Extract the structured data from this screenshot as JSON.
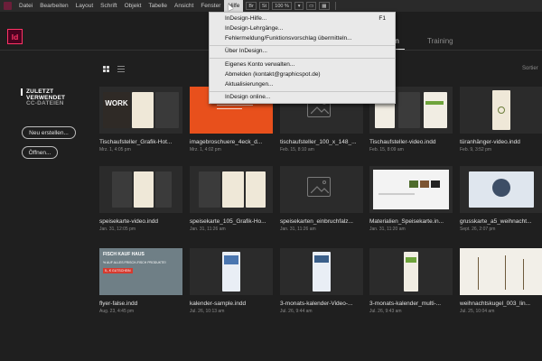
{
  "app": {
    "logo_text": "Id"
  },
  "menubar": {
    "items": [
      "Datei",
      "Bearbeiten",
      "Layout",
      "Schrift",
      "Objekt",
      "Tabelle",
      "Ansicht",
      "Fenster",
      "Hilfe"
    ],
    "active": "Hilfe",
    "zoom": "100 %"
  },
  "help_menu": {
    "items": [
      {
        "label": "InDesign-Hilfe...",
        "shortcut": "F1"
      },
      {
        "label": "InDesign-Lehrgänge..."
      },
      {
        "label": "Fehlermeldung/Funktionsvorschlag übermitteln..."
      },
      {
        "label": "Über InDesign..."
      },
      {
        "label": "Eigenes Konto verwalten..."
      },
      {
        "label": "Abmelden (kontakt@graphicspot.de)"
      },
      {
        "label": "Aktualisierungen..."
      },
      {
        "label": "InDesign online..."
      }
    ]
  },
  "tabs": {
    "dateien": "ateien",
    "training": "Training"
  },
  "sort_label": "Sortier",
  "sidebar": {
    "recent": "ZULETZT VERWENDET",
    "cc": "CC-DATEIEN",
    "new_button": "Neu erstellen...",
    "open_button": "Öffnen..."
  },
  "files": [
    {
      "name": "Tischaufsteller_Grafik-Hot...",
      "date": "Mrz. 1, 4:05 pm",
      "thumb": "work"
    },
    {
      "name": "imagebroschuere_4eck_d...",
      "date": "Mrz. 1, 4:02 pm",
      "thumb": "orange"
    },
    {
      "name": "tischaufsteller_100_x_148_...",
      "date": "Feb. 15, 8:10 am",
      "thumb": "placeholder"
    },
    {
      "name": "Tischaufsteller-video.indd",
      "date": "Feb. 15, 8:09 am",
      "thumb": "tisch"
    },
    {
      "name": "türanhänger-video.indd",
      "date": "Feb. 9, 3:52 pm",
      "thumb": "tuer"
    },
    {
      "name": "speisekarte-video.indd",
      "date": "Jan. 31, 12:05 pm",
      "thumb": "speise"
    },
    {
      "name": "speisekarte_105_Grafik-Ho...",
      "date": "Jan. 31, 11:26 am",
      "thumb": "speise2"
    },
    {
      "name": "speisekarten_einbruchfalz...",
      "date": "Jan. 31, 11:26 am",
      "thumb": "placeholder"
    },
    {
      "name": "Materialien_Speisekarte.in...",
      "date": "Jan. 31, 11:20 am",
      "thumb": "material"
    },
    {
      "name": "grusskarte_a5_weihnacht...",
      "date": "Sept. 26, 2:07 pm",
      "thumb": "gruss"
    },
    {
      "name": "flyer-false.indd",
      "date": "Aug. 23, 4:45 pm",
      "thumb": "flyer"
    },
    {
      "name": "kalender-sample.indd",
      "date": "Jul. 26, 10:13 am",
      "thumb": "kal1"
    },
    {
      "name": "3-monats-kalender-Video-...",
      "date": "Jul. 26, 9:44 am",
      "thumb": "kal2"
    },
    {
      "name": "3-monats-kalender_multi-...",
      "date": "Jul. 26, 9:43 am",
      "thumb": "kal3"
    },
    {
      "name": "weihnachtskugel_003_lin...",
      "date": "Jul. 25, 10:04 am",
      "thumb": "weih"
    }
  ],
  "thumb_text": {
    "work": "WORK",
    "flyer_title": "FISCH KAUF HAUS",
    "flyer_line": "% AUF ALLES FRISCH-FISCH PRODUKTE!",
    "flyer_badge": "5,- € GUTSCHEIN"
  },
  "colors": {
    "accent_pink": "#ff3366",
    "logo_bg": "#49021f",
    "orange": "#e8501c",
    "menu_bg": "#e9e9e9"
  }
}
